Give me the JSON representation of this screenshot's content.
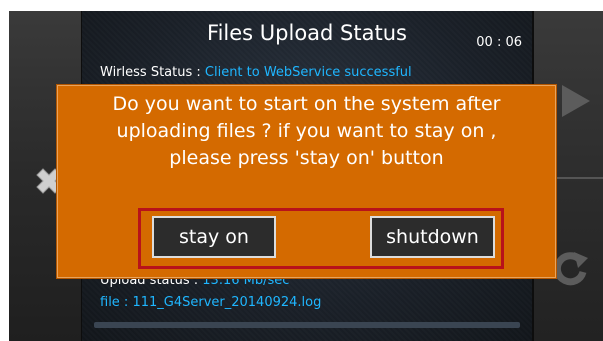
{
  "header": {
    "title": "Files Upload Status",
    "timer": "00 : 06"
  },
  "status": {
    "wireless_label": "Wirless Status : ",
    "wireless_value": "Client to WebService successful",
    "upload_label": "Upload status : ",
    "upload_value": "13.16 Mb/sec",
    "file_label": "file : 111_G4Server_20140924.log"
  },
  "progress": {
    "fraction": 0.0
  },
  "dialog": {
    "message_line1": "Do you want to start on the system after",
    "message_line2": "uploading files ? if you want to stay on ,",
    "message_line3": "please press 'stay on' button",
    "stay_on_label": "stay on",
    "shutdown_label": "shutdown"
  },
  "icons": {
    "left": "close-x-icon",
    "right_top": "play-icon",
    "right_bottom": "refresh-icon"
  },
  "colors": {
    "dialog_bg": "#d46a00",
    "highlight_frame": "#b8121a",
    "status_value": "#1fb6ff"
  }
}
